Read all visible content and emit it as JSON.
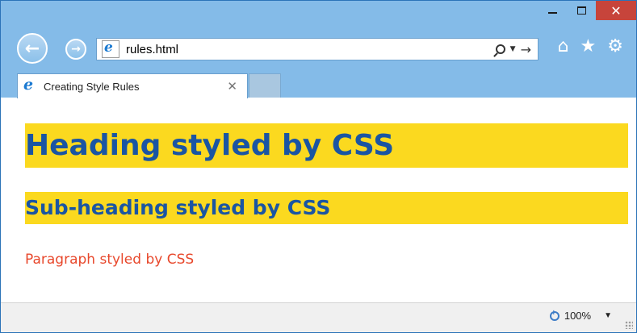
{
  "window": {
    "minimize_icon": "minimize-icon",
    "maximize_icon": "maximize-icon",
    "close_glyph": "✕"
  },
  "nav": {
    "back_glyph": "←",
    "forward_glyph": "→",
    "address_value": "rules.html",
    "go_glyph": "→",
    "dropdown_glyph": "▼"
  },
  "toolbar_icons": {
    "home": "⌂",
    "favorites": "★",
    "settings": "⚙"
  },
  "tabs": [
    {
      "label": "Creating Style Rules",
      "close_glyph": "✕"
    }
  ],
  "page": {
    "heading": "Heading styled by CSS",
    "subheading": "Sub-heading styled by CSS",
    "paragraph": "Paragraph styled by CSS"
  },
  "statusbar": {
    "zoom_level": "100%",
    "zoom_caret": "▼"
  },
  "colors": {
    "chrome": "#84bbe8",
    "close_button": "#c7443b",
    "heading_background": "#fbd91f",
    "heading_text": "#1a55a3",
    "paragraph_text": "#e8482c"
  }
}
